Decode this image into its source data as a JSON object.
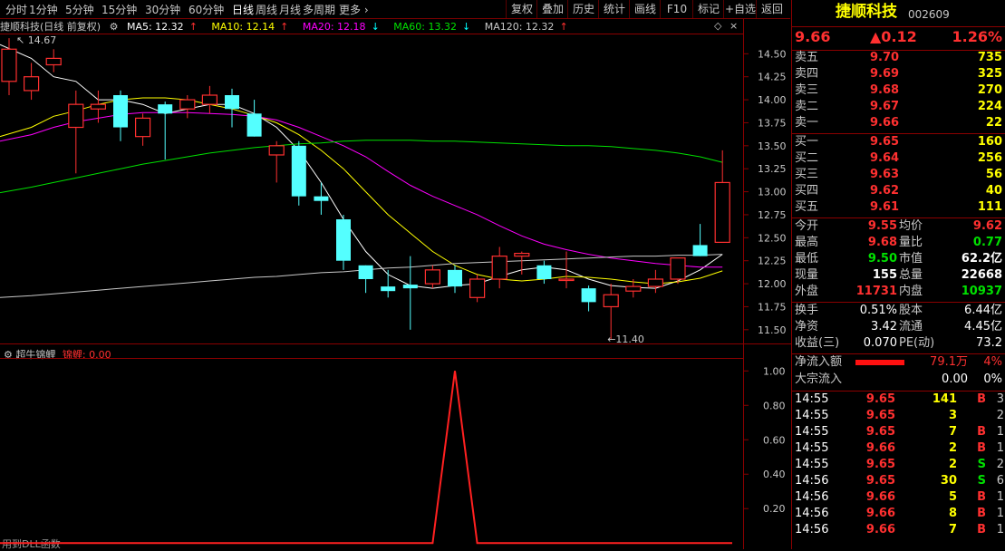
{
  "toolbar": {
    "periods": [
      "分时",
      "1分钟",
      "5分钟",
      "15分钟",
      "30分钟",
      "60分钟",
      "日线",
      "周线",
      "月线",
      "多周期",
      "更多"
    ],
    "active_period": "日线",
    "buttons": [
      "复权",
      "叠加",
      "历史",
      "统计",
      "画线",
      "F10",
      "标记",
      "+自选",
      "返回"
    ]
  },
  "chart_header": {
    "title": "捷顺科技(日线 前复权)",
    "ma5": "MA5: 12.32",
    "ma10": "MA10: 12.14",
    "ma20": "MA20: 12.18",
    "ma60": "MA60: 13.32",
    "ma120": "MA120: 12.32",
    "ma5_arrow": "↑",
    "ma10_arrow": "↑",
    "ma20_arrow": "↓",
    "ma60_arrow": "↓",
    "ma120_arrow": "↑"
  },
  "indicator_header": {
    "name": "超牛锦鲤",
    "series_label": "锦鲤: 0.00"
  },
  "footer_text": "用到DLL函数",
  "colors": {
    "up": "#ff3030",
    "down": "#54ffff",
    "ma5": "#ffffff",
    "ma10": "#ffff00",
    "ma20": "#ff00ff",
    "ma60": "#00e000",
    "ma120": "#c8c8c8",
    "axis": "#8b0000"
  },
  "chart_data": [
    {
      "type": "candlestick",
      "title": "捷顺科技(日线 前复权)",
      "y_ticks": [
        "14.50",
        "14.25",
        "14.00",
        "13.75",
        "13.50",
        "13.25",
        "13.00",
        "12.75",
        "12.50",
        "12.25",
        "12.00",
        "11.75",
        "11.50"
      ],
      "ylim": [
        11.38,
        14.72
      ],
      "annotations": [
        {
          "text": "14.67",
          "value": 14.67,
          "arrow": "↖"
        },
        {
          "text": "11.40",
          "value": 11.4,
          "arrow": "←"
        }
      ],
      "candles": [
        {
          "o": 14.2,
          "h": 14.67,
          "l": 14.05,
          "c": 14.55
        },
        {
          "o": 14.1,
          "h": 14.4,
          "l": 14.0,
          "c": 14.25
        },
        {
          "o": 14.38,
          "h": 14.55,
          "l": 14.3,
          "c": 14.45
        },
        {
          "o": 13.7,
          "h": 14.1,
          "l": 13.2,
          "c": 13.95
        },
        {
          "o": 13.9,
          "h": 14.1,
          "l": 13.75,
          "c": 13.95
        },
        {
          "o": 14.05,
          "h": 14.1,
          "l": 13.55,
          "c": 13.7
        },
        {
          "o": 13.6,
          "h": 13.85,
          "l": 13.5,
          "c": 13.8
        },
        {
          "o": 13.95,
          "h": 13.98,
          "l": 13.35,
          "c": 13.85
        },
        {
          "o": 13.9,
          "h": 14.05,
          "l": 13.8,
          "c": 14.0
        },
        {
          "o": 13.95,
          "h": 14.15,
          "l": 13.85,
          "c": 14.05
        },
        {
          "o": 14.05,
          "h": 14.12,
          "l": 13.7,
          "c": 13.9
        },
        {
          "o": 13.85,
          "h": 14.0,
          "l": 13.6,
          "c": 13.6
        },
        {
          "o": 13.4,
          "h": 13.55,
          "l": 13.1,
          "c": 13.5
        },
        {
          "o": 13.5,
          "h": 13.55,
          "l": 12.85,
          "c": 12.95
        },
        {
          "o": 12.95,
          "h": 13.1,
          "l": 12.75,
          "c": 12.9
        },
        {
          "o": 12.7,
          "h": 12.75,
          "l": 12.15,
          "c": 12.25
        },
        {
          "o": 12.2,
          "h": 12.2,
          "l": 11.9,
          "c": 12.05
        },
        {
          "o": 11.97,
          "h": 12.15,
          "l": 11.85,
          "c": 11.92
        },
        {
          "o": 11.99,
          "h": 12.3,
          "l": 11.5,
          "c": 11.95
        },
        {
          "o": 12.0,
          "h": 12.2,
          "l": 11.95,
          "c": 12.15
        },
        {
          "o": 12.15,
          "h": 12.2,
          "l": 11.9,
          "c": 11.97
        },
        {
          "o": 11.85,
          "h": 12.1,
          "l": 11.8,
          "c": 12.05
        },
        {
          "o": 12.05,
          "h": 12.4,
          "l": 11.95,
          "c": 12.3
        },
        {
          "o": 12.3,
          "h": 12.35,
          "l": 12.1,
          "c": 12.33
        },
        {
          "o": 12.2,
          "h": 12.25,
          "l": 12.0,
          "c": 12.05
        },
        {
          "o": 12.05,
          "h": 12.35,
          "l": 11.95,
          "c": 12.05
        },
        {
          "o": 11.95,
          "h": 11.98,
          "l": 11.7,
          "c": 11.8
        },
        {
          "o": 11.75,
          "h": 12.0,
          "l": 11.4,
          "c": 11.88
        },
        {
          "o": 11.92,
          "h": 12.05,
          "l": 11.85,
          "c": 11.97
        },
        {
          "o": 11.97,
          "h": 12.15,
          "l": 11.9,
          "c": 12.05
        },
        {
          "o": 12.05,
          "h": 12.25,
          "l": 12.0,
          "c": 12.28
        },
        {
          "o": 12.42,
          "h": 12.65,
          "l": 12.3,
          "c": 12.3
        },
        {
          "o": 12.45,
          "h": 13.45,
          "l": 12.45,
          "c": 13.1
        }
      ],
      "ma_series": [
        {
          "name": "MA5",
          "values": [
            14.6,
            14.45,
            14.25,
            14.2,
            14.0,
            14.0,
            13.95,
            13.85,
            13.9,
            13.95,
            13.95,
            13.85,
            13.7,
            13.45,
            13.1,
            12.7,
            12.35,
            12.1,
            11.98,
            11.95,
            11.98,
            12.0,
            12.08,
            12.15,
            12.18,
            12.15,
            12.05,
            11.98,
            11.96,
            11.95,
            12.03,
            12.15,
            12.32
          ]
        },
        {
          "name": "MA10",
          "values": [
            13.6,
            13.7,
            13.82,
            13.88,
            13.95,
            14.0,
            14.02,
            14.02,
            14.0,
            13.95,
            13.9,
            13.83,
            13.75,
            13.62,
            13.45,
            13.25,
            13.0,
            12.75,
            12.55,
            12.35,
            12.2,
            12.1,
            12.05,
            12.03,
            12.05,
            12.08,
            12.07,
            12.05,
            12.02,
            12.0,
            12.02,
            12.06,
            12.14
          ]
        },
        {
          "name": "MA20",
          "values": [
            13.55,
            13.62,
            13.7,
            13.76,
            13.8,
            13.84,
            13.86,
            13.86,
            13.86,
            13.85,
            13.84,
            13.82,
            13.78,
            13.7,
            13.6,
            13.5,
            13.38,
            13.22,
            13.07,
            12.95,
            12.85,
            12.75,
            12.63,
            12.52,
            12.43,
            12.37,
            12.32,
            12.28,
            12.25,
            12.22,
            12.2,
            12.18,
            12.18
          ]
        },
        {
          "name": "MA60",
          "values": [
            12.99,
            13.05,
            13.1,
            13.15,
            13.2,
            13.25,
            13.3,
            13.34,
            13.38,
            13.42,
            13.45,
            13.48,
            13.5,
            13.52,
            13.53,
            13.55,
            13.56,
            13.56,
            13.56,
            13.55,
            13.55,
            13.54,
            13.53,
            13.52,
            13.51,
            13.5,
            13.5,
            13.49,
            13.47,
            13.45,
            13.42,
            13.38,
            13.32
          ]
        },
        {
          "name": "MA120",
          "values": [
            11.85,
            11.87,
            11.89,
            11.91,
            11.93,
            11.95,
            11.97,
            11.99,
            12.01,
            12.03,
            12.05,
            12.07,
            12.08,
            12.1,
            12.12,
            12.13,
            12.15,
            12.17,
            12.18,
            12.2,
            12.22,
            12.23,
            12.24,
            12.25,
            12.26,
            12.27,
            12.28,
            12.29,
            12.3,
            12.3,
            12.31,
            12.31,
            12.32
          ]
        }
      ]
    },
    {
      "type": "line",
      "title": "超牛锦鲤",
      "series": [
        {
          "name": "锦鲤",
          "values": [
            0,
            0,
            0,
            0,
            0,
            0,
            0,
            0,
            0,
            0,
            0,
            0,
            0,
            0,
            0,
            0,
            0,
            0,
            0,
            0,
            1,
            0,
            0,
            0,
            0,
            0,
            0,
            0,
            0,
            0,
            0,
            0,
            0
          ]
        }
      ],
      "y_ticks": [
        "1.00",
        "0.80",
        "0.60",
        "0.40",
        "0.20"
      ],
      "ylim": [
        -0.02,
        1.07
      ]
    }
  ],
  "quote": {
    "name": "捷顺科技",
    "code": "002609",
    "price": "9.66",
    "change": "▲0.12",
    "change_pct": "1.26%",
    "asks": [
      {
        "label": "卖五",
        "price": "9.70",
        "vol": "735"
      },
      {
        "label": "卖四",
        "price": "9.69",
        "vol": "325"
      },
      {
        "label": "卖三",
        "price": "9.68",
        "vol": "270"
      },
      {
        "label": "卖二",
        "price": "9.67",
        "vol": "224"
      },
      {
        "label": "卖一",
        "price": "9.66",
        "vol": "22"
      }
    ],
    "bids": [
      {
        "label": "买一",
        "price": "9.65",
        "vol": "160"
      },
      {
        "label": "买二",
        "price": "9.64",
        "vol": "256"
      },
      {
        "label": "买三",
        "price": "9.63",
        "vol": "56"
      },
      {
        "label": "买四",
        "price": "9.62",
        "vol": "40"
      },
      {
        "label": "买五",
        "price": "9.61",
        "vol": "111"
      }
    ],
    "stats": [
      {
        "l1": "今开",
        "v1": "9.55",
        "c1": "red",
        "l2": "均价",
        "v2": "9.62",
        "c2": "red"
      },
      {
        "l1": "最高",
        "v1": "9.68",
        "c1": "red",
        "l2": "量比",
        "v2": "0.77",
        "c2": "green"
      },
      {
        "l1": "最低",
        "v1": "9.50",
        "c1": "green",
        "l2": "市值",
        "v2": "62.2亿",
        "c2": "white"
      },
      {
        "l1": "现量",
        "v1": "155",
        "c1": "white",
        "l2": "总量",
        "v2": "22668",
        "c2": "white"
      },
      {
        "l1": "外盘",
        "v1": "11731",
        "c1": "red",
        "l2": "内盘",
        "v2": "10937",
        "c2": "green"
      }
    ],
    "stats2": [
      {
        "l1": "换手",
        "v1": "0.51%",
        "l2": "股本",
        "v2": "6.44亿"
      },
      {
        "l1": "净资",
        "v1": "3.42",
        "l2": "流通",
        "v2": "4.45亿"
      },
      {
        "l1": "收益(三)",
        "v1": "0.070",
        "l2": "PE(动)",
        "v2": "73.2"
      }
    ],
    "flow": [
      {
        "label": "净流入额",
        "value": "79.1万",
        "pct": "4%",
        "bar": true,
        "ratio": 0.9
      },
      {
        "label": "大宗流入",
        "value": "0.00",
        "pct": "0%",
        "bar": false,
        "ratio": 0
      }
    ],
    "ticks": [
      {
        "time": "14:55",
        "price": "9.65",
        "vol": "141",
        "side": "B",
        "n": "3"
      },
      {
        "time": "14:55",
        "price": "9.65",
        "vol": "3",
        "side": "",
        "n": "2"
      },
      {
        "time": "14:55",
        "price": "9.65",
        "vol": "7",
        "side": "B",
        "n": "1"
      },
      {
        "time": "14:55",
        "price": "9.66",
        "vol": "2",
        "side": "B",
        "n": "1"
      },
      {
        "time": "14:55",
        "price": "9.65",
        "vol": "2",
        "side": "S",
        "n": "2"
      },
      {
        "time": "14:56",
        "price": "9.65",
        "vol": "30",
        "side": "S",
        "n": "6"
      },
      {
        "time": "14:56",
        "price": "9.66",
        "vol": "5",
        "side": "B",
        "n": "1"
      },
      {
        "time": "14:56",
        "price": "9.66",
        "vol": "8",
        "side": "B",
        "n": "1"
      },
      {
        "time": "14:56",
        "price": "9.66",
        "vol": "7",
        "side": "B",
        "n": "1"
      }
    ]
  }
}
